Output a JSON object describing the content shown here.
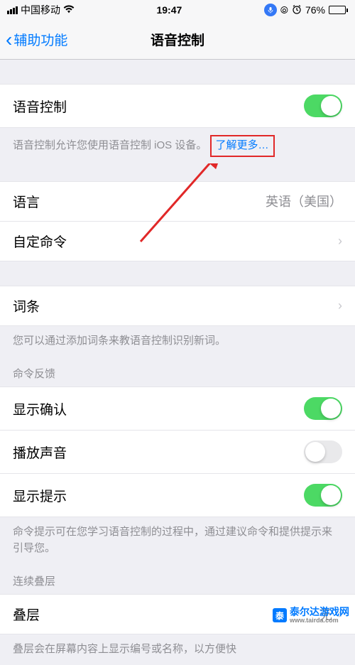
{
  "statusBar": {
    "carrier": "中国移动",
    "time": "19:47",
    "battery": "76%"
  },
  "nav": {
    "back": "辅助功能",
    "title": "语音控制"
  },
  "voiceControl": {
    "label": "语音控制",
    "toggleOn": true,
    "description": "语音控制允许您使用语音控制 iOS 设备。",
    "learnMore": "了解更多…"
  },
  "language": {
    "label": "语言",
    "value": "英语（美国）"
  },
  "customCommands": {
    "label": "自定命令"
  },
  "vocabulary": {
    "label": "词条",
    "description": "您可以通过添加词条来教语音控制识别新词。"
  },
  "commandFeedback": {
    "header": "命令反馈",
    "showConfirm": "显示确认",
    "playSound": "播放声音",
    "showHints": "显示提示",
    "footer": "命令提示可在您学习语音控制的过程中，通过建议命令和提供提示来引导您。"
  },
  "overlay": {
    "header": "连续叠层",
    "label": "叠层",
    "value": "无",
    "footer": "叠层会在屏幕内容上显示编号或名称，以方便快"
  },
  "watermark": {
    "text": "泰尔达游戏网",
    "url": "www.tairda.com"
  }
}
